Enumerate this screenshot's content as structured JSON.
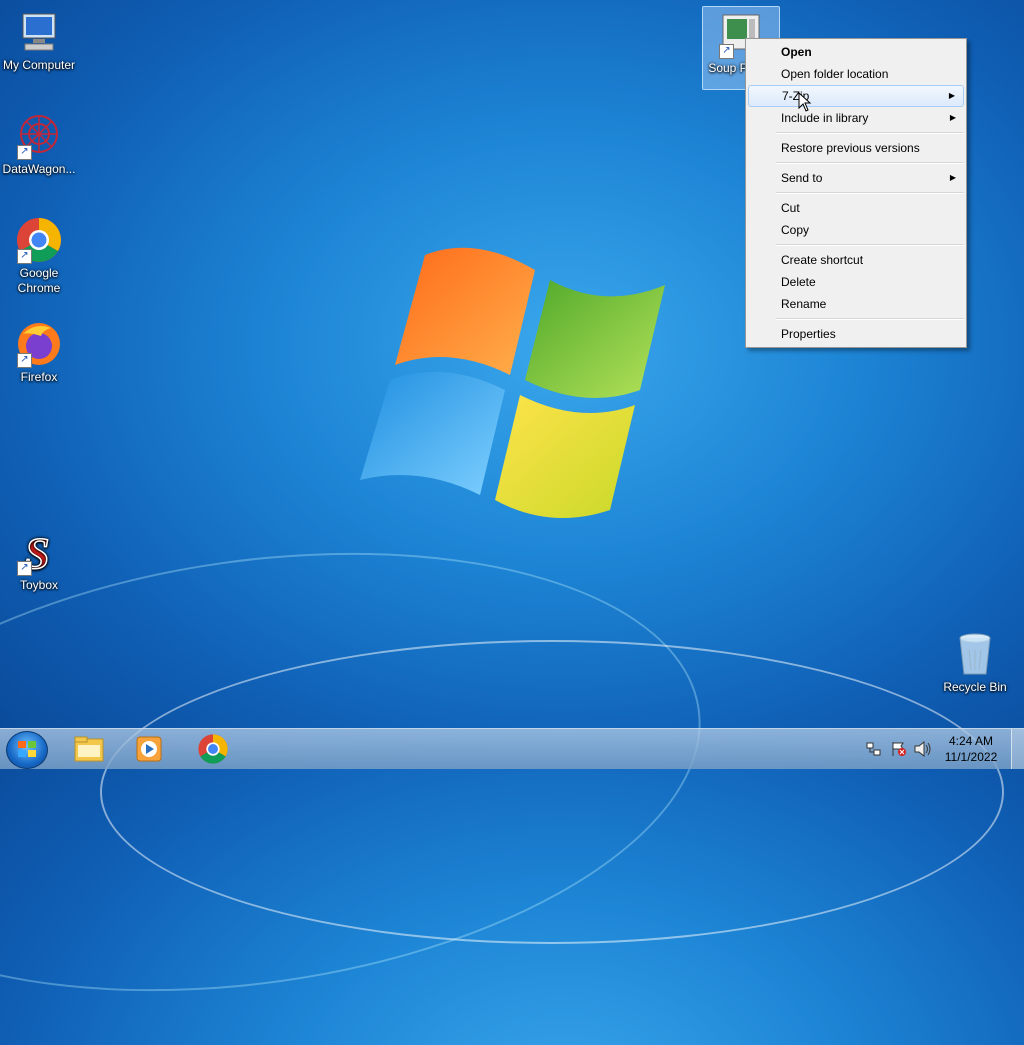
{
  "desktop": {
    "icons": [
      {
        "label": "My Computer"
      },
      {
        "label": "DataWagon..."
      },
      {
        "label": "Google Chrome"
      },
      {
        "label": "Firefox"
      },
      {
        "label": "Toybox"
      },
      {
        "label": "Recycle Bin"
      },
      {
        "label": "Soup Player"
      }
    ]
  },
  "context_menu": {
    "items": [
      {
        "label": "Open"
      },
      {
        "label": "Open folder location"
      },
      {
        "label": "7-Zip"
      },
      {
        "label": "Include in library"
      },
      {
        "label": "Restore previous versions"
      },
      {
        "label": "Send to"
      },
      {
        "label": "Cut"
      },
      {
        "label": "Copy"
      },
      {
        "label": "Create shortcut"
      },
      {
        "label": "Delete"
      },
      {
        "label": "Rename"
      },
      {
        "label": "Properties"
      }
    ]
  },
  "taskbar": {
    "clock_time": "4:24 AM",
    "clock_date": "11/1/2022"
  },
  "colors": {
    "accent": "#1e86d6",
    "menu_bg": "#f0f0f0",
    "hover": "#dceafb"
  }
}
